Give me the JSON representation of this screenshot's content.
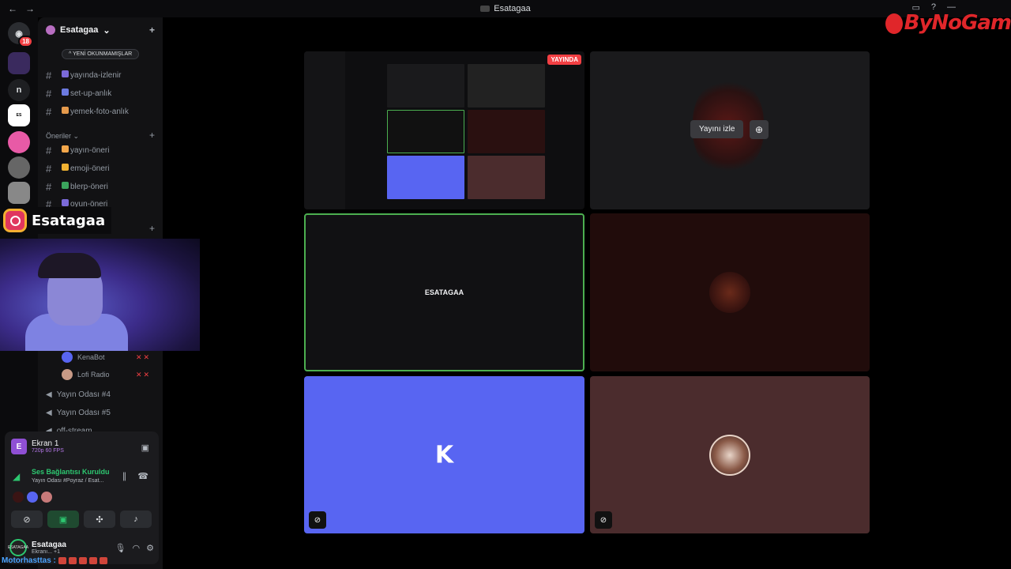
{
  "window": {
    "title": "Esatagaa",
    "watermark": "ByNoGam"
  },
  "rail": {
    "badge_count": "18",
    "dm_letter": "n"
  },
  "server": {
    "name": "Esatagaa",
    "unread_label": "YENİ OKUNMAMIŞLAR"
  },
  "channels": [
    {
      "name": "yayında-izlenir",
      "emoji_color": "#7b6ad9"
    },
    {
      "name": "set-up-anlık",
      "emoji_color": "#6c7ae0"
    },
    {
      "name": "yemek-foto-anlık",
      "emoji_color": "#e59a4c"
    }
  ],
  "category_oneriler": "Öneriler",
  "suggestion_channels": [
    {
      "name": "yayın-öneri",
      "emoji_color": "#f2a74b"
    },
    {
      "name": "emoji-öneri",
      "emoji_color": "#f0b232"
    },
    {
      "name": "blerp-öneri",
      "emoji_color": "#3ba55d"
    },
    {
      "name": "oyun-öneri",
      "emoji_color": "#7b6ad9"
    }
  ],
  "instagram": {
    "handle": "Esatagaa"
  },
  "voice_users": [
    {
      "name": "KenaBot",
      "color": "#5865f2"
    },
    {
      "name": "Lofi Radio",
      "color": "#c89a86"
    }
  ],
  "voice_channels": [
    "Yayın Odası #4",
    "Yayın Odası #5",
    "off-stream"
  ],
  "screen_share": {
    "title": "Ekran 1",
    "quality": "720p 60 FPS",
    "letter": "E"
  },
  "connection": {
    "status": "Ses Bağlantısı Kuruldu",
    "location": "Yayın Odası #Poyraz / Esat..."
  },
  "user": {
    "name": "Esatagaa",
    "status": "Ekranı...",
    "extra": "+1",
    "avatar_text": "ESATAGAA"
  },
  "ticker": {
    "label": "Motorhasttas :"
  },
  "tiles": {
    "live_badge": "YAYINDA",
    "watch_button": "Yayını izle",
    "esatagaa_label": "ESATAGAA",
    "kena_logo": "K"
  }
}
